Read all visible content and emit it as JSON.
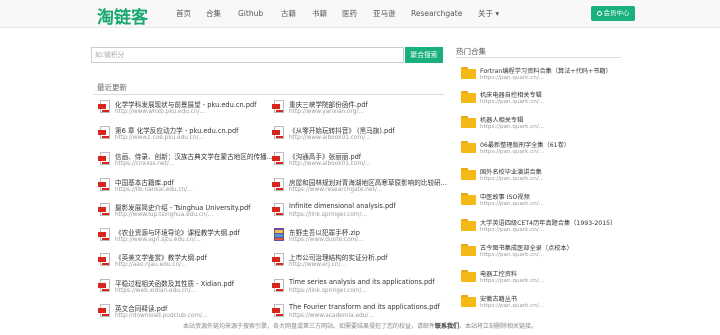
{
  "header": {
    "logo": "淘链客",
    "menu": [
      "首页",
      "合集",
      "Github",
      "古籍",
      "书籍",
      "医药",
      "亚马逊",
      "Researchgate",
      "关于 ▾"
    ],
    "member_button": "会员中心"
  },
  "search": {
    "placeholder": "如:微积分",
    "button": "聚合搜索"
  },
  "recent": {
    "title": "最近更新",
    "left": [
      {
        "title": "化学学科发展现状与前景展望 - pku.edu.cn.pdf",
        "url": "http://www.whxb.pku.edu.cn/..."
      },
      {
        "title": "第6 章 化学反应动力学 - pku.edu.cn.pdf",
        "url": "http://www2.coe.pku.edu.cn/..."
      },
      {
        "title": "信画、侍录、创新：汉族古典文学在蒙古地区的传播...",
        "url": "https://cnxxss.net/..."
      },
      {
        "title": "中国基本古籍库.pdf",
        "url": "https://lib.nankai.edu.cn/..."
      },
      {
        "title": "摄影发展简史介绍 - Tsinghua University.pdf",
        "url": "http://www.lup.tsinghua.edu.cn/..."
      },
      {
        "title": "《农业资源与环境导论》课程教学大纲.pdf",
        "url": "http://www.agri.sjtu.edu.cn/..."
      },
      {
        "title": "《英美文学鉴赏》教学大纲.pdf",
        "url": "http://aao.njau.edu.cn/..."
      },
      {
        "title": "平稳过程相关函数及其性质 - Xidian.pdf",
        "url": "https://web.xidian.edu.cn/..."
      },
      {
        "title": "英文合同释读.pdf",
        "url": "http://download.pudclub.com/..."
      }
    ],
    "right": [
      {
        "title": "重庆三峡学院部份函件.pdf",
        "url": "http://www.yanxian.org/..."
      },
      {
        "title": "《从零开始玩转抖音》 (黑马旗).pdf",
        "url": "http://www.aibook01.com/..."
      },
      {
        "title": "《沟通高手》张丽丽.pdf",
        "url": "http://www.aibook01.com/..."
      },
      {
        "title": "房屋和园林规划对青海湖地区高寒草原影响的比较研...",
        "url": "https://www.researchgate.net/..."
      },
      {
        "title": "Infinite dimensional analysis.pdf",
        "url": "https://link.springer.com/..."
      },
      {
        "title": "东野圭吾以犯罪手杯.zip",
        "url": "https://www.duote.com/..."
      },
      {
        "title": "上市公司治理结构的实证分析.pdf",
        "url": "http://www.erj.cn/..."
      },
      {
        "title": "Time series analysis and its applications.pdf",
        "url": "https://link.springer.com/..."
      },
      {
        "title": "The Fourier transform and its applications.pdf",
        "url": "https://www.academia.edu/..."
      }
    ]
  },
  "popular": {
    "title": "热门合集",
    "items": [
      {
        "title": "Fortran编程学习资料合集（算法+代码+书籍）",
        "url": "https://pan.quark.cn/..."
      },
      {
        "title": "机床电器自控相关专辑",
        "url": "https://pan.quark.cn/..."
      },
      {
        "title": "机器人相关专辑",
        "url": "https://pan.quark.cn/..."
      },
      {
        "title": "06最新整理版刑字全集（61卷）",
        "url": "https://pan.quark.cn/..."
      },
      {
        "title": "国外名校毕业演讲合集",
        "url": "https://pan.quark.cn/..."
      },
      {
        "title": "中医故事 ISO视频",
        "url": "https://pan.quark.cn/..."
      },
      {
        "title": "大学英语四级CET4历年真题合集（1993-2015）",
        "url": "https://pan.quark.cn/..."
      },
      {
        "title": "古今图书集成医部全录（点校本）",
        "url": "https://pan.quark.cn/..."
      },
      {
        "title": "电器工控资料",
        "url": "https://pan.quark.cn/..."
      },
      {
        "title": "安徽古籍丛书",
        "url": "https://pan.quark.cn/..."
      }
    ]
  },
  "footer": {
    "text_before": "本站资源外链均来源于搜索引擎，各大网盘或第三方网站。如需要结果侵犯了您的权益，请邮件",
    "link": "联系我们",
    "text_after": "，本站将立刻删除相关链接。"
  },
  "colors": {
    "accent": "#18b07b",
    "folder": "#f5b916",
    "pdf": "#d9261c"
  }
}
